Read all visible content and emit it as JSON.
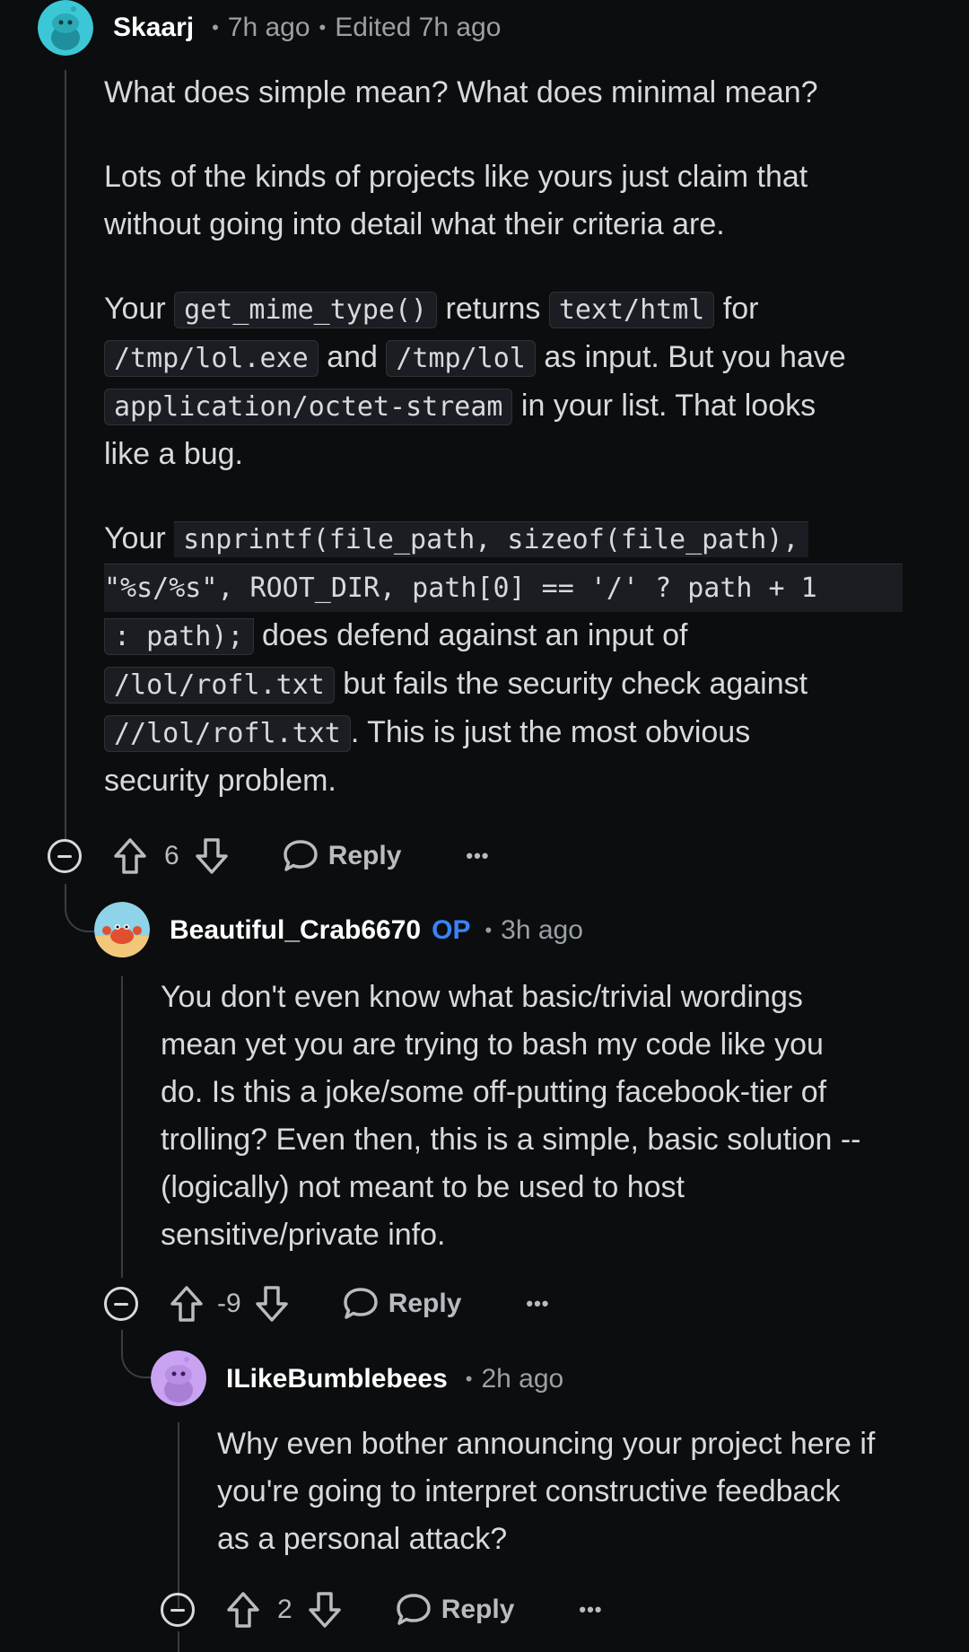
{
  "comments": [
    {
      "username": "Skaarj",
      "time": "7h ago",
      "edited": "Edited 7h ago",
      "avatar_color": "#3cc7d6",
      "p1": "What does simple mean? What does minimal mean?",
      "p2": "Lots of the kinds of projects like yours just claim that without going into detail what their criteria are.",
      "p3": {
        "t1": "Your ",
        "c1": "get_mime_type()",
        "t2": " returns ",
        "c2": "text/html",
        "t3": " for",
        "c3": "/tmp/lol.exe",
        "t4": " and ",
        "c4": "/tmp/lol",
        "t5": " as input. But you have",
        "c5": "application/octet-stream",
        "t6": " in your list. That looks",
        "t7": "like a bug."
      },
      "p4": {
        "t1": "Your ",
        "code_line1": "snprintf(file_path, sizeof(file_path),",
        "code_line2": "\"%s/%s\", ROOT_DIR, path[0] == '/' ? path + 1",
        "code_line3": ": path);",
        "t2": " does defend against an input of",
        "c1": "/lol/rofl.txt",
        "t3": " but fails the security check against",
        "c2": "//lol/rofl.txt",
        "t4": ". This is just the most obvious",
        "t5": "security problem."
      },
      "votes": "6",
      "reply_label": "Reply",
      "more_label": "•••"
    },
    {
      "username": "Beautiful_Crab6670",
      "op_badge": "OP",
      "time": "3h ago",
      "avatar_color": "#f0b04a",
      "lines": [
        "You don't even know what basic/trivial wordings",
        "mean yet you are trying to bash my code like you",
        "do. Is this a joke/some off-putting facebook-tier of",
        "trolling? Even then, this is a simple, basic solution --",
        "(logically) not meant to be used to host",
        "sensitive/private info."
      ],
      "votes": "-9",
      "reply_label": "Reply",
      "more_label": "•••"
    },
    {
      "username": "ILikeBumblebees",
      "time": "2h ago",
      "avatar_color": "#c9a2f2",
      "lines": [
        "Why even bother announcing your project here if",
        "you're going to interpret constructive feedback",
        "as a personal attack?"
      ],
      "votes": "2",
      "reply_label": "Reply",
      "more_label": "•••"
    }
  ]
}
